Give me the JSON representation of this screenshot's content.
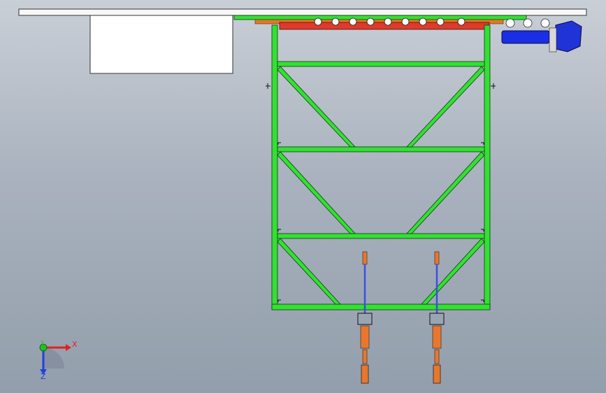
{
  "viewport": {
    "background_top": "#c9cfd7",
    "background_bottom": "#939eac"
  },
  "model": {
    "frame_color": "#33e033",
    "frame_outline": "#0a3a0a",
    "rail_color": "#f7f7f7",
    "drive_motor_color": "#1a2ee6",
    "trolley_color": "#e03a2a",
    "trolley_rack_color": "#e0782a",
    "hoist_rod_color": "#3b4fe0",
    "hoist_body_color": "#e8772e"
  },
  "triad": {
    "x_label": "X",
    "y_label": "Y",
    "z_label": "Z",
    "x_color": "#e02020",
    "y_color": "#20c020",
    "z_color": "#2040e0"
  }
}
